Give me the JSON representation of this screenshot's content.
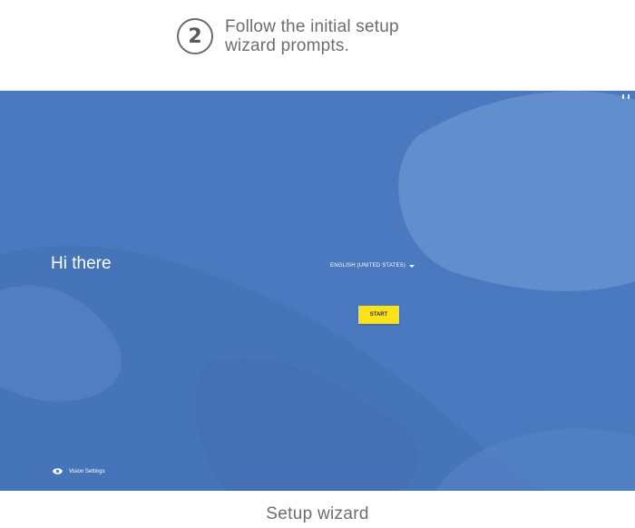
{
  "instruction": {
    "step_number": "2",
    "line1": "Follow the initial setup",
    "line2": "wizard prompts."
  },
  "screen": {
    "greeting": "Hi there",
    "language": "ENGLISH (UNITED STATES)",
    "start_label": "START",
    "vision_settings_label": "Vision Settings",
    "colors": {
      "background": "#4f7dc2",
      "accent_button": "#fbe11b"
    }
  },
  "caption": "Setup wizard"
}
